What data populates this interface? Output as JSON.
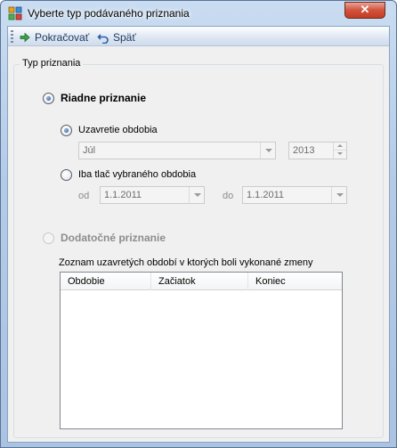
{
  "window": {
    "title": "Vyberte typ podávaného priznania",
    "close_label": "✕",
    "icon": "app-grid-icon"
  },
  "toolbar": {
    "continue_label": "Pokračovať",
    "continue_icon": "arrow-right-icon",
    "back_label": "Späť",
    "back_icon": "undo-icon"
  },
  "group": {
    "legend": "Typ priznania",
    "regular": {
      "label": "Riadne priznanie",
      "checked": true,
      "closing": {
        "label": "Uzavretie obdobia",
        "checked": true,
        "month": "Júl",
        "year": "2013"
      },
      "print_only": {
        "label": "Iba tlač vybraného obdobia",
        "checked": false,
        "from_label": "od",
        "from_value": "1.1.2011",
        "to_label": "do",
        "to_value": "1.1.2011"
      }
    },
    "supplementary": {
      "label": "Dodatočné priznanie",
      "checked": false,
      "enabled": false
    },
    "list": {
      "caption": "Zoznam uzavretých období v ktorých boli vykonané zmeny",
      "columns": [
        "Obdobie",
        "Začiatok",
        "Koniec"
      ],
      "rows": []
    }
  }
}
